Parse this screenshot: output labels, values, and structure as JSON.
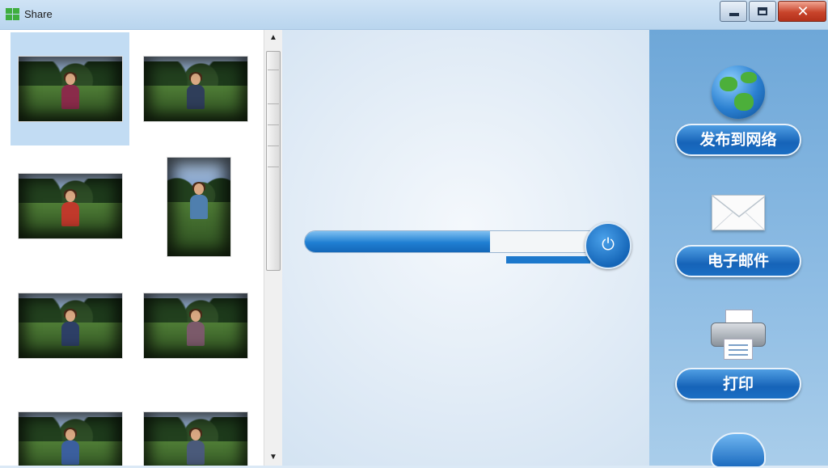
{
  "window": {
    "title": "Share",
    "controls": {
      "minimize": "minimize",
      "maximize": "maximize",
      "close": "✕"
    }
  },
  "thumbnails": {
    "items": [
      {
        "shirt": "#8a2b4a",
        "selected": true
      },
      {
        "shirt": "#2f3e5a",
        "selected": false
      },
      {
        "shirt": "#c0392b",
        "selected": false
      },
      {
        "shirt": "#4f7fae",
        "selected": false
      },
      {
        "shirt": "#2d3f66",
        "selected": false
      },
      {
        "shirt": "#7b5a6a",
        "selected": false
      },
      {
        "shirt": "#3b5f9e",
        "selected": false
      },
      {
        "shirt": "#4a5a7a",
        "selected": false
      }
    ]
  },
  "scrollbar": {
    "up_arrow": "▲",
    "down_arrow": "▼"
  },
  "progress": {
    "value_percent": 62,
    "knob_icon": "⏻"
  },
  "actions": {
    "publish_label": "发布到网络",
    "email_label": "电子邮件",
    "print_label": "打印"
  },
  "colors": {
    "accent": "#1f7fd2",
    "panel": "#8fbde4",
    "selection": "#c2dcf3"
  }
}
